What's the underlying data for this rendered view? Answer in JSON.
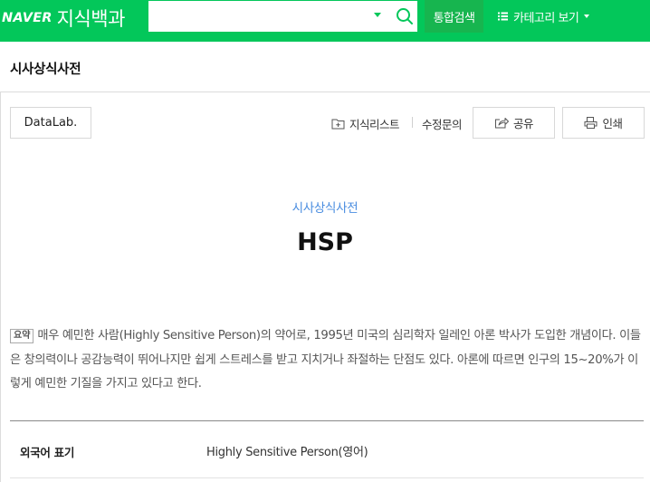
{
  "header": {
    "logo_brand": "NAVER",
    "logo_service": "지식백과",
    "search_value": "",
    "unified_search_label": "통합검색",
    "category_label": "카테고리 보기",
    "brand_color": "#03c75a"
  },
  "dictionary": {
    "name": "시사상식사전"
  },
  "toolbar": {
    "datalab_label": "DataLab.",
    "knowledge_list_label": "지식리스트",
    "edit_inquiry_label": "수정문의",
    "share_label": "공유",
    "print_label": "인쇄"
  },
  "entry": {
    "source": "시사상식사전",
    "title": "HSP",
    "summary_badge": "요약",
    "summary_text": "매우 예민한 사람(Highly Sensitive Person)의 약어로, 1995년 미국의 심리학자 일레인 아론 박사가 도입한 개념이다. 이들은 창의력이나 공감능력이 뛰어나지만 쉽게 스트레스를 받고 지치거나 좌절하는 단점도 있다. 아론에 따르면 인구의 15~20%가 이렇게 예민한 기질을 가지고 있다고 한다.",
    "info": [
      {
        "label": "외국어 표기",
        "value": "Highly Sensitive Person(영어)"
      }
    ]
  },
  "icons": {
    "search": "search-icon",
    "caret": "chevron-down-icon",
    "category_list": "list-icon",
    "knowledge_list": "add-folder-icon",
    "share": "share-icon",
    "print": "print-icon"
  }
}
